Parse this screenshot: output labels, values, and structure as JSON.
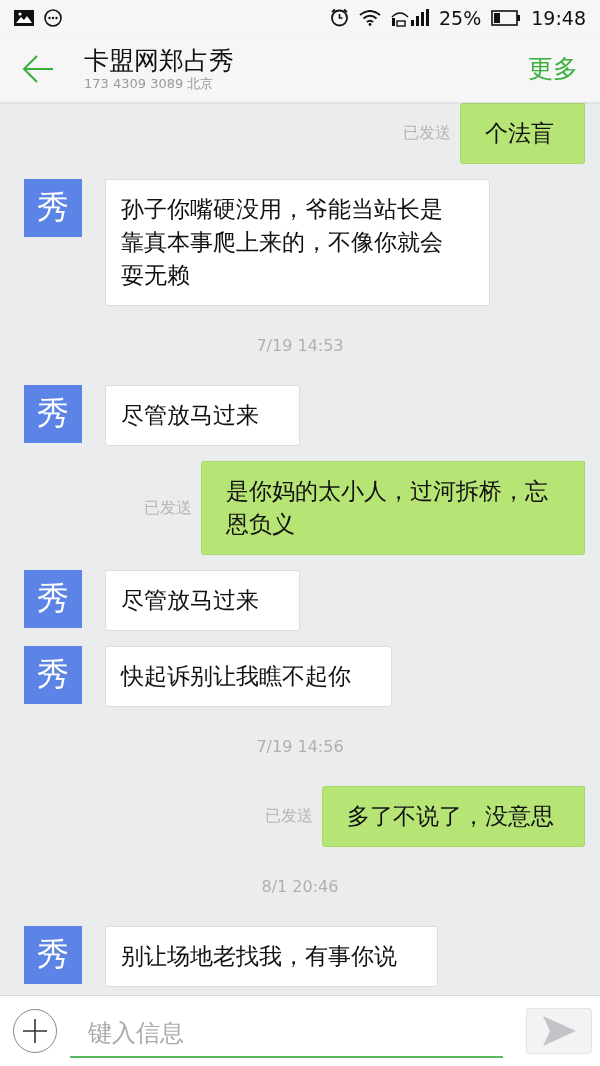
{
  "status_bar": {
    "time": "19:48",
    "battery": "25%"
  },
  "header": {
    "title": "卡盟网郑占秀",
    "subtitle": "173 4309 3089 北京",
    "more": "更多"
  },
  "messages": [
    {
      "kind": "outgoing",
      "status": "已发送",
      "text": "个法盲"
    },
    {
      "kind": "incoming",
      "avatar": "秀",
      "text": "孙子你嘴硬没用，爷能当站长是靠真本事爬上来的，不像你就会耍无赖"
    },
    {
      "kind": "time",
      "text": "7/19 14:53"
    },
    {
      "kind": "incoming",
      "avatar": "秀",
      "text": "尽管放马过来"
    },
    {
      "kind": "outgoing",
      "status": "已发送",
      "text": "是你妈的太小人，过河拆桥，忘恩负义"
    },
    {
      "kind": "incoming",
      "avatar": "秀",
      "text": "尽管放马过来"
    },
    {
      "kind": "incoming",
      "avatar": "秀",
      "text": "快起诉别让我瞧不起你"
    },
    {
      "kind": "time",
      "text": "7/19 14:56"
    },
    {
      "kind": "outgoing",
      "status": "已发送",
      "text": "多了不说了，没意思"
    },
    {
      "kind": "time",
      "text": "8/1 20:46"
    },
    {
      "kind": "incoming",
      "avatar": "秀",
      "text": "别让场地老找我，有事你说"
    }
  ],
  "composer": {
    "placeholder": "键入信息"
  }
}
